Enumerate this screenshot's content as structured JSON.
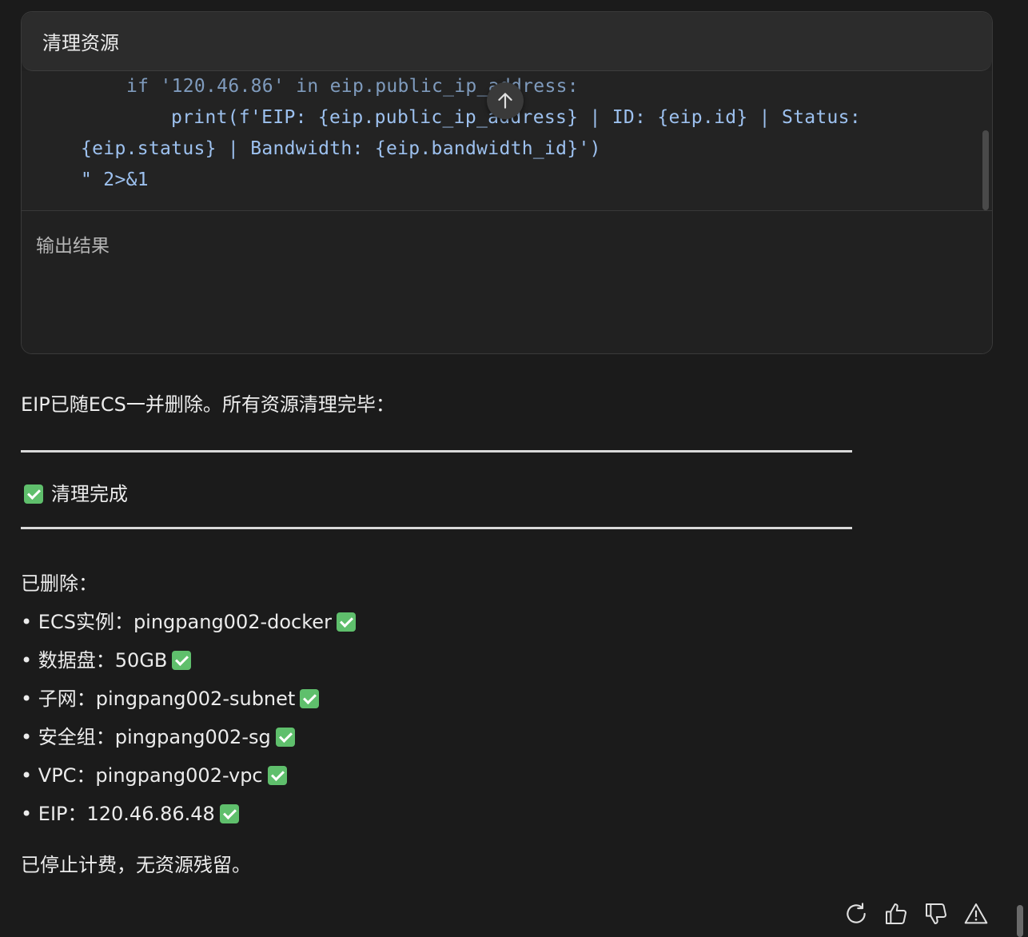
{
  "tool": {
    "title": "清理资源",
    "code_lines": [
      "if '120.46.86' in eip.public_ip_address:",
      "print(f'EIP: {eip.public_ip_address} | ID: {eip.id} | Status:",
      "{eip.status} | Bandwidth: {eip.bandwidth_id}')",
      "\" 2>&1"
    ],
    "output_label": "输出结果"
  },
  "message": {
    "intro": "EIP已随ECS一并删除。所有资源清理完毕：",
    "heading": "清理完成",
    "deleted_label": "已删除：",
    "items": [
      "• ECS实例：pingpang002-docker",
      "• 数据盘：50GB",
      "• 子网：pingpang002-subnet",
      "• 安全组：pingpang002-sg",
      "• VPC：pingpang002-vpc",
      "• EIP：120.46.86.48"
    ],
    "footer": "已停止计费，无资源残留。"
  },
  "icons": {
    "scroll_up": "arrow-up-icon",
    "check": "check-mark-icon",
    "actions": [
      "refresh-icon",
      "thumbs-up-icon",
      "thumbs-down-icon",
      "warning-icon"
    ]
  },
  "colors": {
    "background": "#1b1b1b",
    "code_text": "#9dc1ef",
    "check_green": "#5fbf6c"
  }
}
